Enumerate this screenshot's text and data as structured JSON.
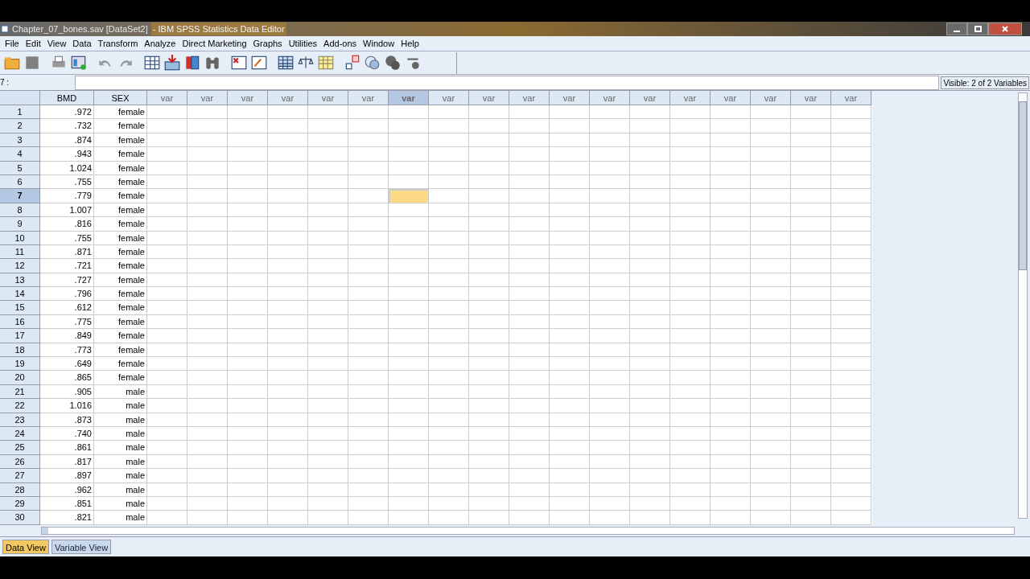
{
  "window": {
    "title_file": "Chapter_07_bones.sav [DataSet2]",
    "title_app": "- IBM SPSS Statistics Data Editor"
  },
  "menu": [
    "File",
    "Edit",
    "View",
    "Data",
    "Transform",
    "Analyze",
    "Direct Marketing",
    "Graphs",
    "Utilities",
    "Add-ons",
    "Window",
    "Help"
  ],
  "cell_editor": {
    "cell_ref": "7 :",
    "visible": "Visible: 2 of 2 Variables"
  },
  "table": {
    "columns": [
      {
        "label": "BMD",
        "kind": "variable",
        "selected": false
      },
      {
        "label": "SEX",
        "kind": "variable",
        "selected": false
      },
      {
        "label": "var",
        "kind": "empty",
        "selected": false
      },
      {
        "label": "var",
        "kind": "empty",
        "selected": false
      },
      {
        "label": "var",
        "kind": "empty",
        "selected": false
      },
      {
        "label": "var",
        "kind": "empty",
        "selected": false
      },
      {
        "label": "var",
        "kind": "empty",
        "selected": false
      },
      {
        "label": "var",
        "kind": "empty",
        "selected": false
      },
      {
        "label": "var",
        "kind": "empty",
        "selected": true
      },
      {
        "label": "var",
        "kind": "empty",
        "selected": false
      },
      {
        "label": "var",
        "kind": "empty",
        "selected": false
      },
      {
        "label": "var",
        "kind": "empty",
        "selected": false
      },
      {
        "label": "var",
        "kind": "empty",
        "selected": false
      },
      {
        "label": "var",
        "kind": "empty",
        "selected": false
      },
      {
        "label": "var",
        "kind": "empty",
        "selected": false
      },
      {
        "label": "var",
        "kind": "empty",
        "selected": false
      },
      {
        "label": "var",
        "kind": "empty",
        "selected": false
      },
      {
        "label": "var",
        "kind": "empty",
        "selected": false
      },
      {
        "label": "var",
        "kind": "empty",
        "selected": false
      },
      {
        "label": "var",
        "kind": "empty",
        "selected": false
      }
    ],
    "rows": [
      {
        "case": "1",
        "values": [
          ".972",
          "female"
        ],
        "selected": false
      },
      {
        "case": "2",
        "values": [
          ".732",
          "female"
        ],
        "selected": false
      },
      {
        "case": "3",
        "values": [
          ".874",
          "female"
        ],
        "selected": false
      },
      {
        "case": "4",
        "values": [
          ".943",
          "female"
        ],
        "selected": false
      },
      {
        "case": "5",
        "values": [
          "1.024",
          "female"
        ],
        "selected": false
      },
      {
        "case": "6",
        "values": [
          ".755",
          "female"
        ],
        "selected": false
      },
      {
        "case": "7",
        "values": [
          ".779",
          "female"
        ],
        "selected": true
      },
      {
        "case": "8",
        "values": [
          "1.007",
          "female"
        ],
        "selected": false
      },
      {
        "case": "9",
        "values": [
          ".816",
          "female"
        ],
        "selected": false
      },
      {
        "case": "10",
        "values": [
          ".755",
          "female"
        ],
        "selected": false
      },
      {
        "case": "11",
        "values": [
          ".871",
          "female"
        ],
        "selected": false
      },
      {
        "case": "12",
        "values": [
          ".721",
          "female"
        ],
        "selected": false
      },
      {
        "case": "13",
        "values": [
          ".727",
          "female"
        ],
        "selected": false
      },
      {
        "case": "14",
        "values": [
          ".796",
          "female"
        ],
        "selected": false
      },
      {
        "case": "15",
        "values": [
          ".612",
          "female"
        ],
        "selected": false
      },
      {
        "case": "16",
        "values": [
          ".775",
          "female"
        ],
        "selected": false
      },
      {
        "case": "17",
        "values": [
          ".849",
          "female"
        ],
        "selected": false
      },
      {
        "case": "18",
        "values": [
          ".773",
          "female"
        ],
        "selected": false
      },
      {
        "case": "19",
        "values": [
          ".649",
          "female"
        ],
        "selected": false
      },
      {
        "case": "20",
        "values": [
          ".865",
          "female"
        ],
        "selected": false
      },
      {
        "case": "21",
        "values": [
          ".905",
          "male"
        ],
        "selected": false
      },
      {
        "case": "22",
        "values": [
          "1.016",
          "male"
        ],
        "selected": false
      },
      {
        "case": "23",
        "values": [
          ".873",
          "male"
        ],
        "selected": false
      },
      {
        "case": "24",
        "values": [
          ".740",
          "male"
        ],
        "selected": false
      },
      {
        "case": "25",
        "values": [
          ".861",
          "male"
        ],
        "selected": false
      },
      {
        "case": "26",
        "values": [
          ".817",
          "male"
        ],
        "selected": false
      },
      {
        "case": "27",
        "values": [
          ".897",
          "male"
        ],
        "selected": false
      },
      {
        "case": "28",
        "values": [
          ".962",
          "male"
        ],
        "selected": false
      },
      {
        "case": "29",
        "values": [
          ".851",
          "male"
        ],
        "selected": false
      },
      {
        "case": "30",
        "values": [
          ".821",
          "male"
        ],
        "selected": false
      }
    ]
  },
  "view_tabs": [
    {
      "label": "Data View",
      "selected": true
    },
    {
      "label": "Variable View",
      "selected": false
    }
  ]
}
